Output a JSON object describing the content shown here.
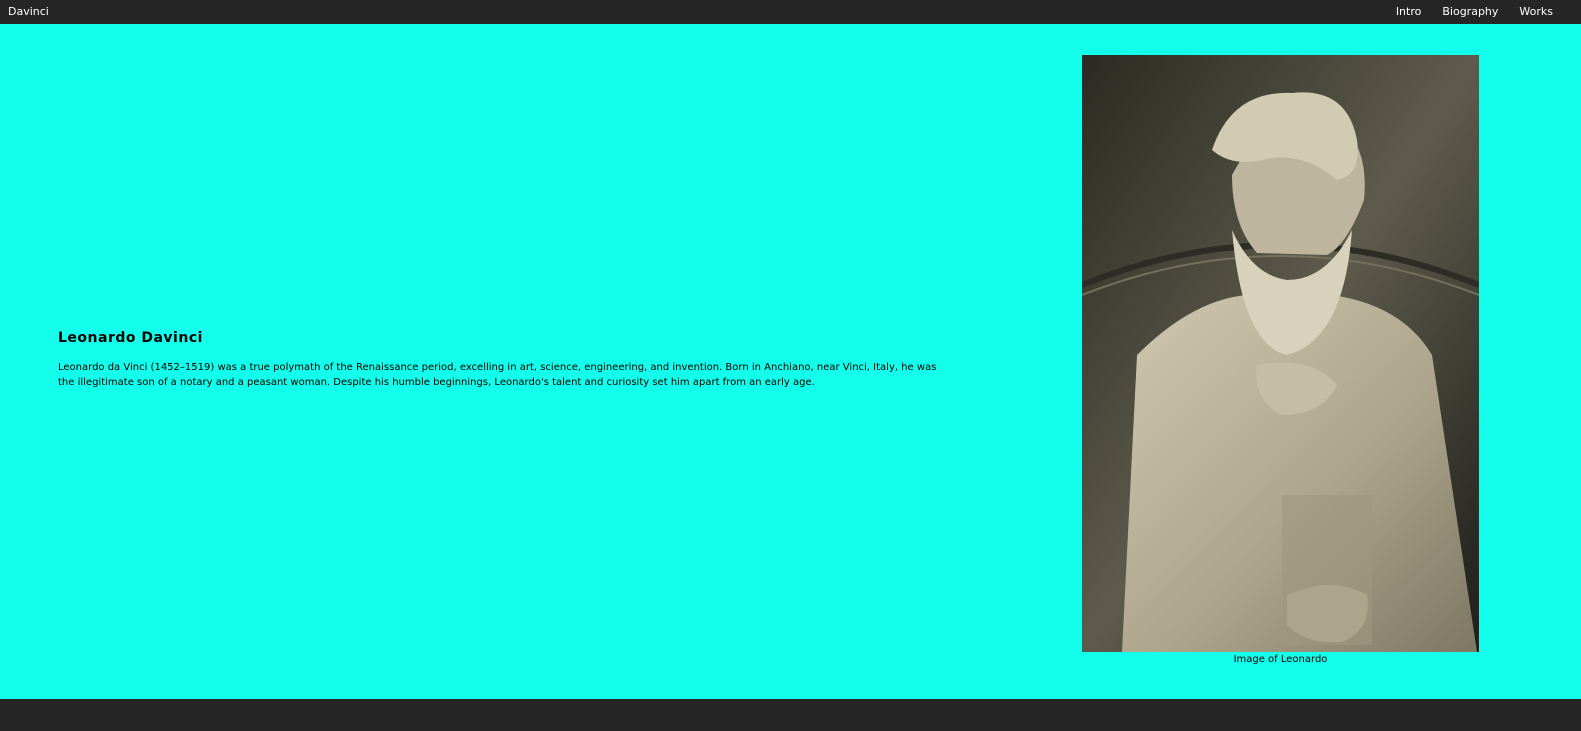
{
  "nav": {
    "brand": "Davinci",
    "links": [
      "Intro",
      "Biography",
      "Works"
    ]
  },
  "main": {
    "title": "Leonardo Davinci",
    "intro": "Leonardo da Vinci (1452–1519) was a true polymath of the Renaissance period, excelling in art, science, engineering, and invention. Born in Anchiano, near Vinci, Italy, he was the illegitimate son of a notary and a peasant woman. Despite his humble beginnings, Leonardo's talent and curiosity set him apart from an early age.",
    "caption": "Image of Leonardo"
  },
  "colors": {
    "nav_background": "#262626",
    "main_background": "#13ffeb",
    "text": "#000000"
  }
}
